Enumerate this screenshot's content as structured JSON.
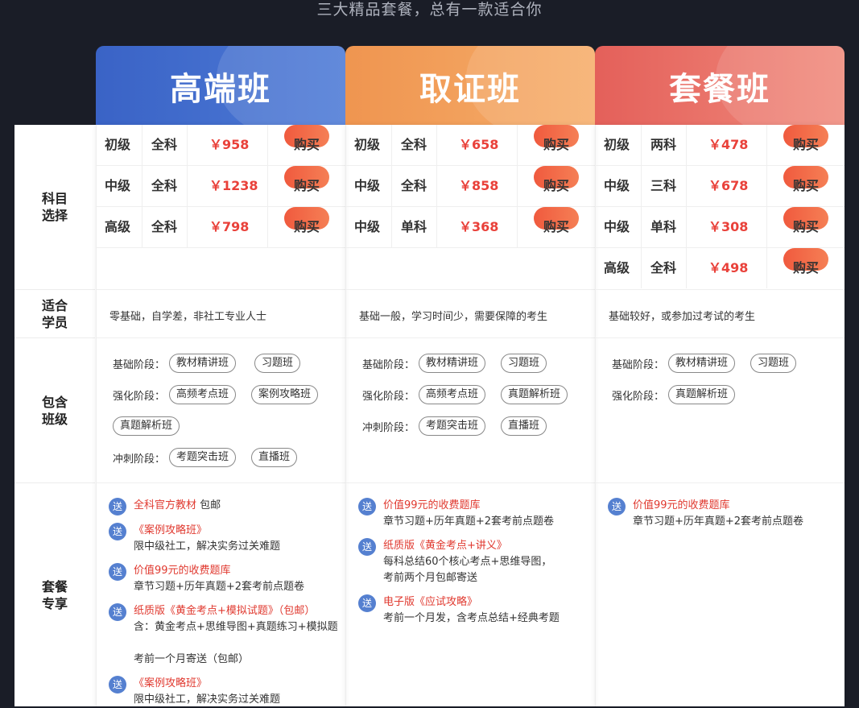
{
  "subtitle": "三大精品套餐，总有一款适合你",
  "headers": [
    "高端班",
    "取证班",
    "套餐班"
  ],
  "row_labels": {
    "subjects": "科目\n选择",
    "audience": "适合\n学员",
    "classes": "包含\n班级",
    "perks": "套餐\n专享"
  },
  "buy_label": "购买",
  "plans": [
    {
      "prices": [
        {
          "level": "初级",
          "subject": "全科",
          "price": "￥958"
        },
        {
          "level": "中级",
          "subject": "全科",
          "price": "￥1238"
        },
        {
          "level": "高级",
          "subject": "全科",
          "price": "￥798"
        }
      ],
      "audience": "零基础，自学差，非社工专业人士",
      "stages": {
        "basic": {
          "label": "基础阶段：",
          "classes": [
            "教材精讲班",
            "习题班"
          ]
        },
        "strong": {
          "label": "强化阶段：",
          "classes": [
            "高频考点班",
            "案例攻略班",
            "真题解析班"
          ]
        },
        "sprint": {
          "label": "冲刺阶段：",
          "classes": [
            "考题突击班",
            "直播班"
          ]
        }
      },
      "gift_badge": "送",
      "gifts": [
        {
          "title": "全科官方教材",
          "title_suffix": " 包邮",
          "desc": ""
        },
        {
          "title": "《案例攻略班》",
          "desc": "限中级社工，解决实务过关难题"
        },
        {
          "title": "价值99元的收费题库",
          "desc": "章节习题+历年真题+2套考前点题卷"
        },
        {
          "title": "纸质版《黄金考点+模拟试题》（包邮）",
          "desc": "含：黄金考点+思维导图+真题练习+模拟题",
          "desc2": "考前一个月寄送（包邮）"
        },
        {
          "title": "《案例攻略班》",
          "desc": "限中级社工，解决实务过关难题"
        }
      ]
    },
    {
      "prices": [
        {
          "level": "初级",
          "subject": "全科",
          "price": "￥658"
        },
        {
          "level": "中级",
          "subject": "全科",
          "price": "￥858"
        },
        {
          "level": "中级",
          "subject": "单科",
          "price": "￥368"
        }
      ],
      "audience": "基础一般，学习时间少，需要保障的考生",
      "stages": {
        "basic": {
          "label": "基础阶段：",
          "classes": [
            "教材精讲班",
            "习题班"
          ]
        },
        "strong": {
          "label": "强化阶段：",
          "classes": [
            "高频考点班",
            "真题解析班"
          ]
        },
        "sprint": {
          "label": "冲刺阶段：",
          "classes": [
            "考题突击班",
            "直播班"
          ]
        }
      },
      "gifts": [
        {
          "title": "价值99元的收费题库",
          "desc": "章节习题+历年真题+2套考前点题卷"
        },
        {
          "title": "纸质版《黄金考点+讲义》",
          "desc": "每科总结60个核心考点+思维导图，",
          "desc2": "考前两个月包邮寄送"
        },
        {
          "title": "电子版《应试攻略》",
          "desc": "考前一个月发，含考点总结+经典考题"
        }
      ]
    },
    {
      "prices": [
        {
          "level": "初级",
          "subject": "两科",
          "price": "￥478"
        },
        {
          "level": "中级",
          "subject": "三科",
          "price": "￥678"
        },
        {
          "level": "中级",
          "subject": "单科",
          "price": "￥308"
        },
        {
          "level": "高级",
          "subject": "全科",
          "price": "￥498"
        }
      ],
      "audience": "基础较好，或参加过考试的考生",
      "stages": {
        "basic": {
          "label": "基础阶段：",
          "classes": [
            "教材精讲班",
            "习题班"
          ]
        },
        "strong": {
          "label": "强化阶段：",
          "classes": [
            "真题解析班"
          ]
        }
      },
      "gifts": [
        {
          "title": "价值99元的收费题库",
          "desc": "章节习题+历年真题+2套考前点题卷"
        }
      ]
    }
  ]
}
